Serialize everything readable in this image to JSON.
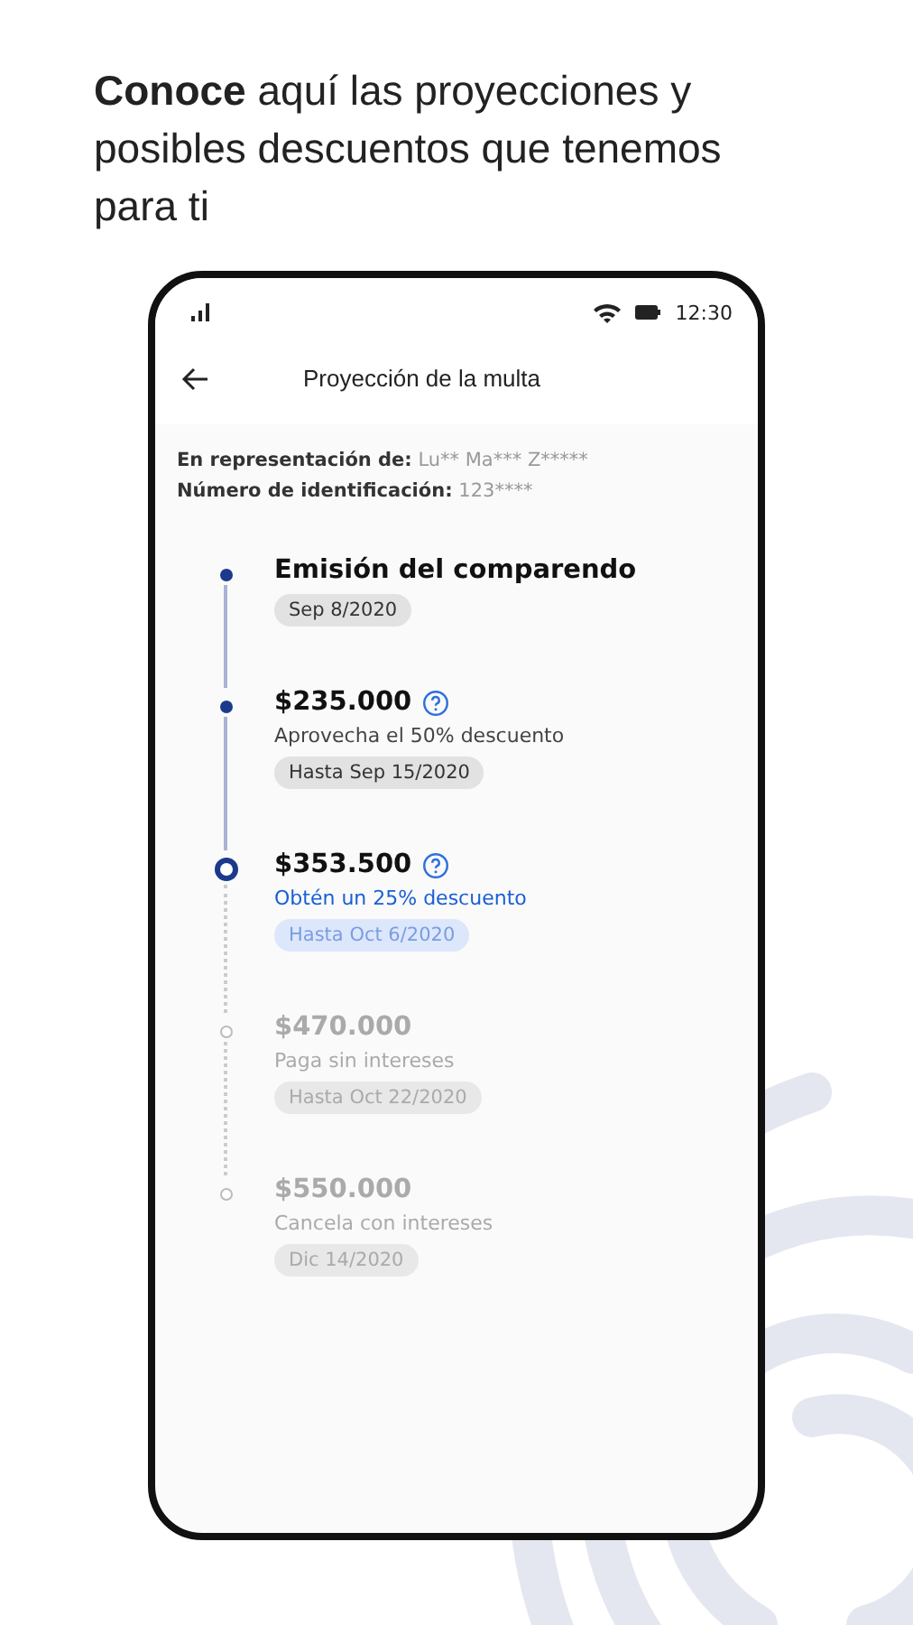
{
  "headline": "**Conoce** aquí las proyecciones y posibles descuentos que tenemos para ti",
  "status_bar": {
    "time": "12:30"
  },
  "header": {
    "title": "Proyección de la multa"
  },
  "info": [
    {
      "label": "En representación de:",
      "value": "Lu** Ma*** Z*****"
    },
    {
      "label": "Número de identificación:",
      "value": "123****"
    }
  ],
  "steps": [
    {
      "kind": "past",
      "title": "Emisión del comparendo",
      "help": false,
      "date": "Sep 8/2020"
    },
    {
      "kind": "past",
      "title": "$235.000",
      "help": true,
      "description": "Aprovecha el 50% descuento",
      "date": "Hasta Sep 15/2020"
    },
    {
      "kind": "current",
      "title": "$353.500",
      "help": true,
      "description": "Obtén un 25% descuento",
      "date": "Hasta Oct 6/2020"
    },
    {
      "kind": "upcoming",
      "title": "$470.000",
      "help": false,
      "description": "Paga sin intereses",
      "date": "Hasta Oct 22/2020"
    },
    {
      "kind": "upcoming",
      "title": "$550.000",
      "help": false,
      "description": "Cancela con intereses",
      "date": "Dic 14/2020"
    }
  ]
}
